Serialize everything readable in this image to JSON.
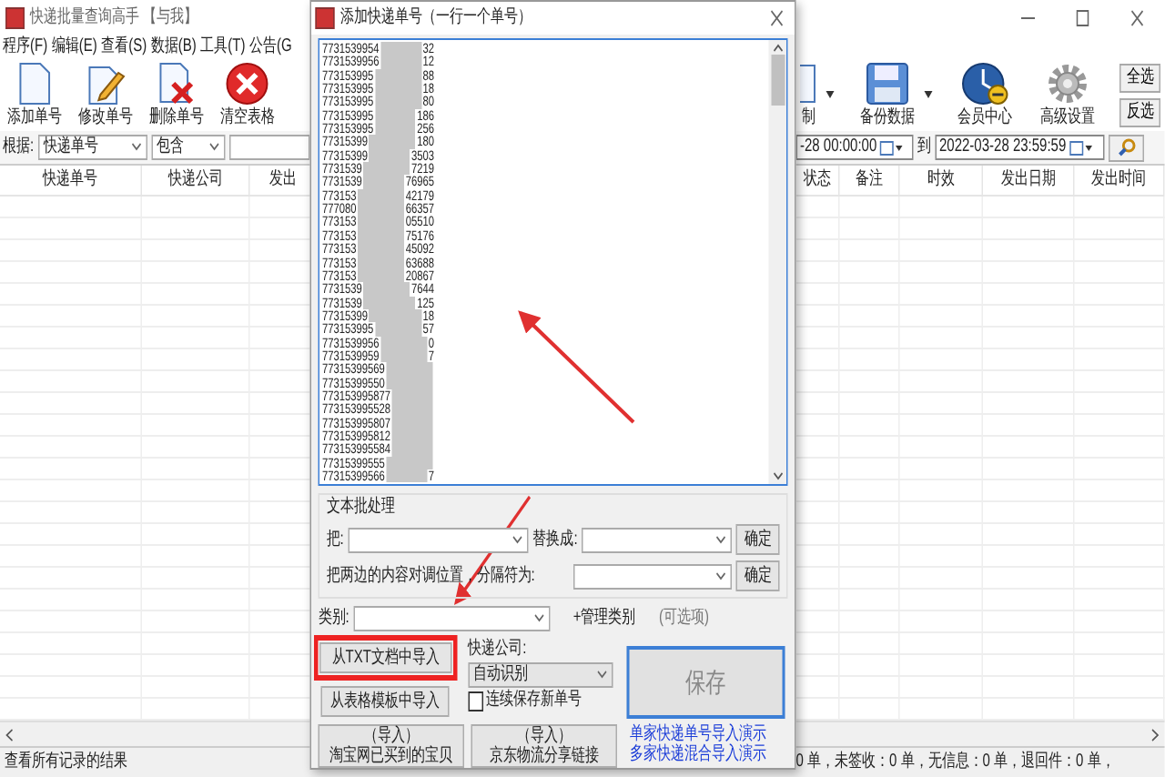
{
  "main_window": {
    "title": "快递批量查询高手 【与我】",
    "menu": [
      "程序(F)",
      "编辑(E)",
      "查看(S)",
      "数据(B)",
      "工具(T)",
      "公告(G"
    ],
    "toolbar_left": [
      {
        "label": "添加单号",
        "kind": "add"
      },
      {
        "label": "修改单号",
        "kind": "edit"
      },
      {
        "label": "删除单号",
        "kind": "delete"
      },
      {
        "label": "清空表格",
        "kind": "clear"
      }
    ],
    "toolbar_right": [
      {
        "label": "制",
        "kind": "copy",
        "dropdown": true
      },
      {
        "label": "备份数据",
        "kind": "save",
        "dropdown": true
      },
      {
        "label": "会员中心",
        "kind": "member",
        "dropdown": false
      },
      {
        "label": "高级设置",
        "kind": "gear",
        "dropdown": false
      }
    ],
    "select_buttons": [
      "全选",
      "反选"
    ],
    "filter": {
      "label": "根据:",
      "field": "快递单号",
      "match": "包含",
      "date_from": "-28 00:00:00",
      "to_label": "到",
      "date_to": "2022-03-28 23:59:59"
    },
    "table": {
      "columns_left": [
        "快递单号",
        "快递公司",
        "发出"
      ],
      "columns_right": [
        "状态",
        "备注",
        "时效",
        "发出日期",
        "发出时间"
      ]
    },
    "status_bar": {
      "message": "查看所有记录的结果",
      "counts": "0 单，未签收：0 单，无信息：0 单，退回件：0 单，"
    }
  },
  "dialog": {
    "title": "添加快递单号（一行一个单号）",
    "numbers": [
      [
        "7731539954",
        "32"
      ],
      [
        "7731539956",
        "12"
      ],
      [
        "773153995",
        "88"
      ],
      [
        "773153995",
        "18"
      ],
      [
        "773153995",
        "80"
      ],
      [
        "773153995",
        "186"
      ],
      [
        "773153995",
        "256"
      ],
      [
        "77315399",
        "180"
      ],
      [
        "77315399",
        "3503"
      ],
      [
        "7731539",
        "7219"
      ],
      [
        "7731539",
        "76965"
      ],
      [
        "773153",
        "42179"
      ],
      [
        "777080",
        "66357"
      ],
      [
        "773153",
        "05510"
      ],
      [
        "773153",
        "75176"
      ],
      [
        "773153",
        "45092"
      ],
      [
        "773153",
        "63688"
      ],
      [
        "773153",
        "20867"
      ],
      [
        "7731539",
        "7644"
      ],
      [
        "7731539",
        "125"
      ],
      [
        "77315399",
        "18"
      ],
      [
        "773153995",
        "57"
      ],
      [
        "7731539956",
        "0"
      ],
      [
        "7731539959",
        "7"
      ],
      [
        "77315399569"
      ],
      [
        "77315399550"
      ],
      [
        "773153995877"
      ],
      [
        "773153995528"
      ],
      [
        "773153995807"
      ],
      [
        "773153995812"
      ],
      [
        "773153995584"
      ],
      [
        "77315399555"
      ],
      [
        "77315399566",
        "7"
      ]
    ],
    "batch_title": "文本批处理",
    "replace_label": "把:",
    "replace_with_label": "替换成:",
    "swap_label": "把两边的内容对调位置，分隔符为:",
    "confirm": [
      "确定",
      "确定"
    ],
    "category_label": "类别:",
    "manage_category": "+管理类别",
    "optional": "(可选项)",
    "import_txt": "从TXT文档中导入",
    "import_template": "从表格模板中导入",
    "courier_label": "快递公司:",
    "courier_value": "自动识别",
    "continuous_save": {
      "label": "连续保存新单号",
      "checked": false
    },
    "save": "保存",
    "import_taobao": [
      "（导入）",
      "淘宝网已买到的宝贝"
    ],
    "import_jd": [
      "（导入）",
      "京东物流分享链接"
    ],
    "links": [
      "单家快递单号导入演示",
      "多家快递混合导入演示"
    ]
  }
}
